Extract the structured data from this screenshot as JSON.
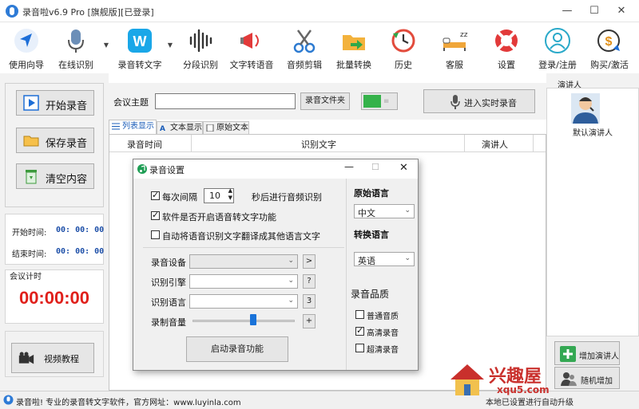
{
  "window": {
    "title": "录音啦v6.9 Pro [旗舰版][已登录]",
    "controls": {
      "minimize": "—",
      "maximize": "☐",
      "close": "✕"
    }
  },
  "toolbar": [
    {
      "label": "使用向导",
      "icon": "navigation-arrow-icon"
    },
    {
      "label": "在线识别",
      "icon": "microphone-icon"
    },
    {
      "label": "录音转文字",
      "icon": "w-logo-icon"
    },
    {
      "label": "分段识别",
      "icon": "waveform-icon"
    },
    {
      "label": "文字转语音",
      "icon": "megaphone-icon"
    },
    {
      "label": "音频剪辑",
      "icon": "scissors-icon"
    },
    {
      "label": "批量转换",
      "icon": "folder-arrow-icon"
    },
    {
      "label": "历史",
      "icon": "history-clock-icon"
    },
    {
      "label": "客服",
      "icon": "bed-sleep-icon"
    },
    {
      "label": "设置",
      "icon": "lifebuoy-icon"
    },
    {
      "label": "登录/注册",
      "icon": "user-icon"
    },
    {
      "label": "购买/激活",
      "icon": "dollar-icon"
    }
  ],
  "left": {
    "start_record": "开始录音",
    "save_record": "保存录音",
    "clear_content": "清空内容",
    "start_time_label": "开始时间:",
    "start_time_value": "00: 00: 00",
    "end_time_label": "结束时间:",
    "end_time_value": "00: 00: 00",
    "meeting_timer_label": "会议计时",
    "meeting_timer_value": "00:00:00",
    "video_tutorial": "视频教程"
  },
  "top": {
    "meeting_topic_label": "会议主题",
    "meeting_topic_value": "",
    "record_folder_button": "录音文件夹",
    "realtime_button": "进入实时录音"
  },
  "tabs": [
    {
      "label": "列表显示",
      "active": true
    },
    {
      "label": "文本显示",
      "active": false
    },
    {
      "label": "原始文本",
      "active": false
    }
  ],
  "grid": {
    "columns": [
      "录音时间",
      "识别文字",
      "演讲人"
    ]
  },
  "right": {
    "speakers_label": "演讲人",
    "default_speaker": "默认演讲人",
    "add_speaker": "增加演讲人",
    "random_add": "随机增加"
  },
  "statusbar": {
    "left_text": "录音啦! 专业的录音转文字软件，官方网址：www.luyinla.com",
    "right_text": "本地已设置进行自动升级"
  },
  "watermark": {
    "brand": "兴趣屋",
    "url": "xqu5.com"
  },
  "dialog": {
    "title": "录音设置",
    "interval_prefix": "每次间隔",
    "interval_value": "10",
    "interval_suffix": "秒后进行音频识别",
    "opt_enable_tts": "软件是否开启语音转文字功能",
    "opt_auto_translate": "自动将语音识别文字翻译成其他语言文字",
    "device_label": "录音设备",
    "engine_label": "识别引擎",
    "language_label": "识别语言",
    "volume_label": "录制音量",
    "device_btn": ">",
    "engine_btn": "?",
    "language_btn": "3",
    "volume_btn": "+",
    "start_button": "启动录音功能",
    "source_lang_label": "原始语言",
    "source_lang_value": "中文",
    "target_lang_label": "转换语言",
    "target_lang_value": "英语",
    "quality_label": "录音品质",
    "quality_normal": "普通音质",
    "quality_hd": "高清录音",
    "quality_uhd": "超清录音",
    "volume_level": 0.6
  },
  "colors": {
    "accent": "#1a5cb8",
    "timer_red": "#e0201b",
    "toggle_green": "#35b24a"
  }
}
